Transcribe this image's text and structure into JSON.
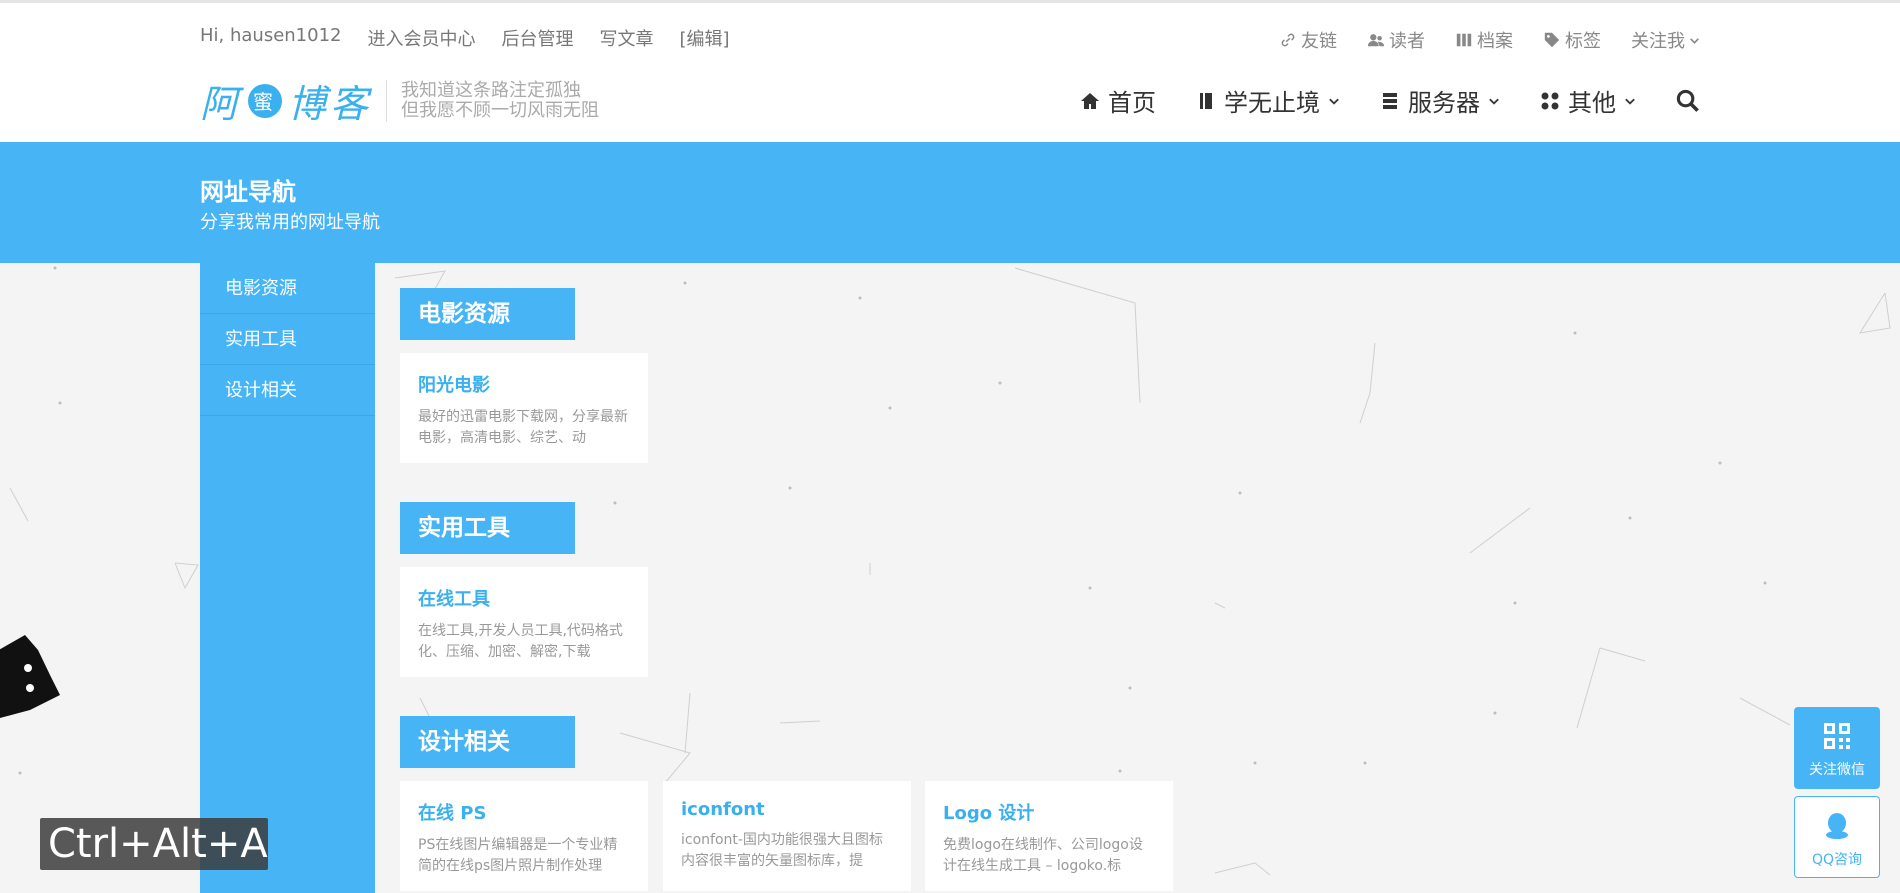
{
  "topbar": {
    "greeting": "Hi, hausen1012",
    "member_center": "进入会员中心",
    "admin": "后台管理",
    "write": "写文章",
    "edit": "[编辑]"
  },
  "topright": {
    "links": "友链",
    "readers": "读者",
    "archive": "档案",
    "tags": "标签",
    "follow": "关注我"
  },
  "logo": {
    "part1": "阿",
    "dot": "蜜",
    "part2": "博客",
    "slogan_line1": "我知道这条路注定孤独",
    "slogan_line2": "但我愿不顾一切风雨无阻"
  },
  "nav": {
    "home": "首页",
    "learn": "学无止境",
    "server": "服务器",
    "other": "其他"
  },
  "banner": {
    "title": "网址导航",
    "subtitle": "分享我常用的网址导航"
  },
  "sidebar": {
    "items": [
      {
        "label": "电影资源"
      },
      {
        "label": "实用工具"
      },
      {
        "label": "设计相关"
      }
    ]
  },
  "sections": [
    {
      "title": "电影资源",
      "cards": [
        {
          "title": "阳光电影",
          "desc": "最好的迅雷电影下载网，分享最新电影，高清电影、综艺、动"
        }
      ]
    },
    {
      "title": "实用工具",
      "cards": [
        {
          "title": "在线工具",
          "desc": "在线工具,开发人员工具,代码格式化、压缩、加密、解密,下载"
        }
      ]
    },
    {
      "title": "设计相关",
      "cards": [
        {
          "title": "在线 PS",
          "desc": "PS在线图片编辑器是一个专业精简的在线ps图片照片制作处理"
        },
        {
          "title": "iconfont",
          "desc": "iconfont-国内功能很强大且图标内容很丰富的矢量图标库，提"
        },
        {
          "title": "Logo 设计",
          "desc": "免费logo在线制作、公司logo设计在线生成工具 – logoko.标"
        }
      ]
    }
  ],
  "floating": {
    "wechat": "关注微信",
    "qq": "QQ咨询"
  },
  "shortcut": "Ctrl+Alt+A",
  "colors": {
    "accent": "#46b4f5",
    "link": "#3ab0ef"
  }
}
